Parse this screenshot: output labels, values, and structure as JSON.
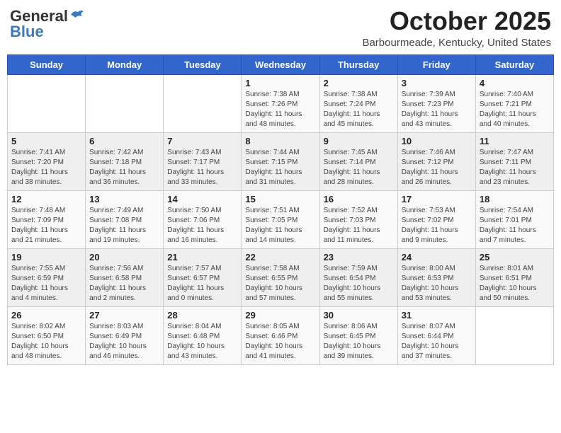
{
  "header": {
    "logo_general": "General",
    "logo_blue": "Blue",
    "month_title": "October 2025",
    "location": "Barbourmeade, Kentucky, United States"
  },
  "weekdays": [
    "Sunday",
    "Monday",
    "Tuesday",
    "Wednesday",
    "Thursday",
    "Friday",
    "Saturday"
  ],
  "weeks": [
    [
      {
        "day": "",
        "info": ""
      },
      {
        "day": "",
        "info": ""
      },
      {
        "day": "",
        "info": ""
      },
      {
        "day": "1",
        "info": "Sunrise: 7:38 AM\nSunset: 7:26 PM\nDaylight: 11 hours and 48 minutes."
      },
      {
        "day": "2",
        "info": "Sunrise: 7:38 AM\nSunset: 7:24 PM\nDaylight: 11 hours and 45 minutes."
      },
      {
        "day": "3",
        "info": "Sunrise: 7:39 AM\nSunset: 7:23 PM\nDaylight: 11 hours and 43 minutes."
      },
      {
        "day": "4",
        "info": "Sunrise: 7:40 AM\nSunset: 7:21 PM\nDaylight: 11 hours and 40 minutes."
      }
    ],
    [
      {
        "day": "5",
        "info": "Sunrise: 7:41 AM\nSunset: 7:20 PM\nDaylight: 11 hours and 38 minutes."
      },
      {
        "day": "6",
        "info": "Sunrise: 7:42 AM\nSunset: 7:18 PM\nDaylight: 11 hours and 36 minutes."
      },
      {
        "day": "7",
        "info": "Sunrise: 7:43 AM\nSunset: 7:17 PM\nDaylight: 11 hours and 33 minutes."
      },
      {
        "day": "8",
        "info": "Sunrise: 7:44 AM\nSunset: 7:15 PM\nDaylight: 11 hours and 31 minutes."
      },
      {
        "day": "9",
        "info": "Sunrise: 7:45 AM\nSunset: 7:14 PM\nDaylight: 11 hours and 28 minutes."
      },
      {
        "day": "10",
        "info": "Sunrise: 7:46 AM\nSunset: 7:12 PM\nDaylight: 11 hours and 26 minutes."
      },
      {
        "day": "11",
        "info": "Sunrise: 7:47 AM\nSunset: 7:11 PM\nDaylight: 11 hours and 23 minutes."
      }
    ],
    [
      {
        "day": "12",
        "info": "Sunrise: 7:48 AM\nSunset: 7:09 PM\nDaylight: 11 hours and 21 minutes."
      },
      {
        "day": "13",
        "info": "Sunrise: 7:49 AM\nSunset: 7:08 PM\nDaylight: 11 hours and 19 minutes."
      },
      {
        "day": "14",
        "info": "Sunrise: 7:50 AM\nSunset: 7:06 PM\nDaylight: 11 hours and 16 minutes."
      },
      {
        "day": "15",
        "info": "Sunrise: 7:51 AM\nSunset: 7:05 PM\nDaylight: 11 hours and 14 minutes."
      },
      {
        "day": "16",
        "info": "Sunrise: 7:52 AM\nSunset: 7:03 PM\nDaylight: 11 hours and 11 minutes."
      },
      {
        "day": "17",
        "info": "Sunrise: 7:53 AM\nSunset: 7:02 PM\nDaylight: 11 hours and 9 minutes."
      },
      {
        "day": "18",
        "info": "Sunrise: 7:54 AM\nSunset: 7:01 PM\nDaylight: 11 hours and 7 minutes."
      }
    ],
    [
      {
        "day": "19",
        "info": "Sunrise: 7:55 AM\nSunset: 6:59 PM\nDaylight: 11 hours and 4 minutes."
      },
      {
        "day": "20",
        "info": "Sunrise: 7:56 AM\nSunset: 6:58 PM\nDaylight: 11 hours and 2 minutes."
      },
      {
        "day": "21",
        "info": "Sunrise: 7:57 AM\nSunset: 6:57 PM\nDaylight: 11 hours and 0 minutes."
      },
      {
        "day": "22",
        "info": "Sunrise: 7:58 AM\nSunset: 6:55 PM\nDaylight: 10 hours and 57 minutes."
      },
      {
        "day": "23",
        "info": "Sunrise: 7:59 AM\nSunset: 6:54 PM\nDaylight: 10 hours and 55 minutes."
      },
      {
        "day": "24",
        "info": "Sunrise: 8:00 AM\nSunset: 6:53 PM\nDaylight: 10 hours and 53 minutes."
      },
      {
        "day": "25",
        "info": "Sunrise: 8:01 AM\nSunset: 6:51 PM\nDaylight: 10 hours and 50 minutes."
      }
    ],
    [
      {
        "day": "26",
        "info": "Sunrise: 8:02 AM\nSunset: 6:50 PM\nDaylight: 10 hours and 48 minutes."
      },
      {
        "day": "27",
        "info": "Sunrise: 8:03 AM\nSunset: 6:49 PM\nDaylight: 10 hours and 46 minutes."
      },
      {
        "day": "28",
        "info": "Sunrise: 8:04 AM\nSunset: 6:48 PM\nDaylight: 10 hours and 43 minutes."
      },
      {
        "day": "29",
        "info": "Sunrise: 8:05 AM\nSunset: 6:46 PM\nDaylight: 10 hours and 41 minutes."
      },
      {
        "day": "30",
        "info": "Sunrise: 8:06 AM\nSunset: 6:45 PM\nDaylight: 10 hours and 39 minutes."
      },
      {
        "day": "31",
        "info": "Sunrise: 8:07 AM\nSunset: 6:44 PM\nDaylight: 10 hours and 37 minutes."
      },
      {
        "day": "",
        "info": ""
      }
    ]
  ]
}
